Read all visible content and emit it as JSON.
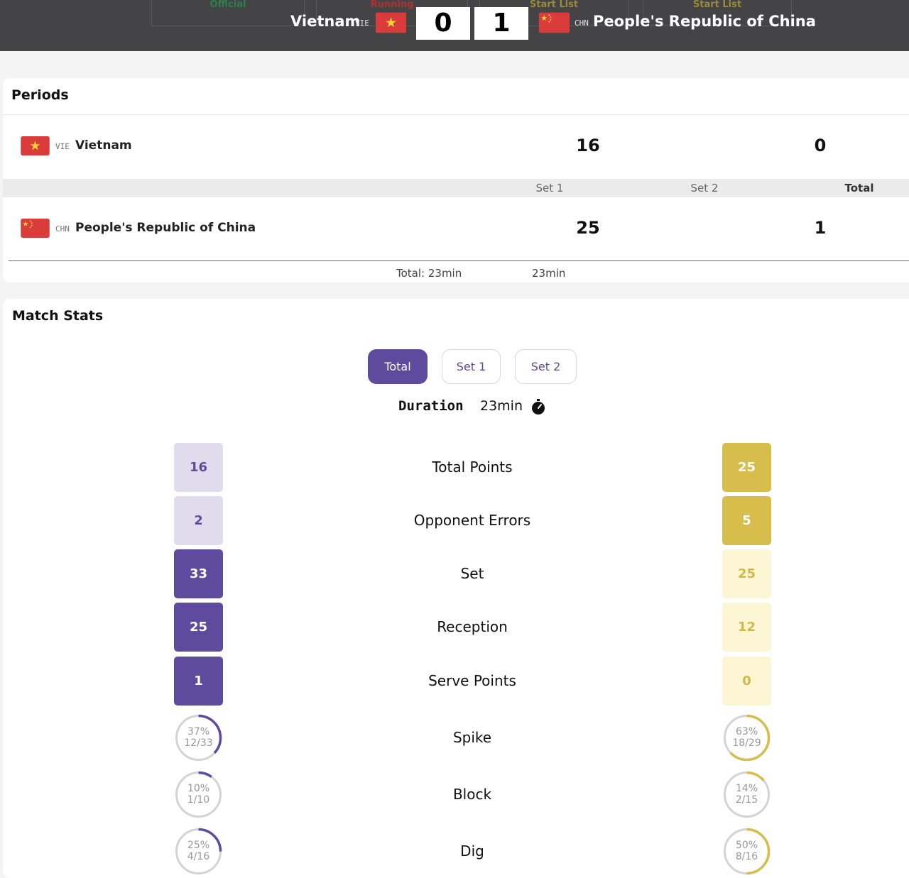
{
  "header": {
    "tabs": [
      {
        "label": "Official",
        "color": "#2e7d4f"
      },
      {
        "label": "Running",
        "color": "#b03030"
      },
      {
        "label": "Start List",
        "color": "#9a8a3a"
      },
      {
        "label": "Start List",
        "color": "#9a8a3a"
      }
    ],
    "home": {
      "name": "Vietnam",
      "code": "VIE",
      "score": "0"
    },
    "away": {
      "name": "People's Republic of China",
      "code": "CHN",
      "score": "1"
    }
  },
  "periods": {
    "title": "Periods",
    "home": {
      "name": "Vietnam",
      "code": "VIE",
      "set1": "16",
      "total": "0"
    },
    "away": {
      "name": "People's Republic of China",
      "code": "CHN",
      "set1": "25",
      "total": "1"
    },
    "columns": {
      "set1": "Set 1",
      "set2": "Set 2",
      "total": "Total"
    },
    "durations": {
      "total": "Total: 23min",
      "set1": "23min"
    }
  },
  "stats": {
    "title": "Match Stats",
    "filters": {
      "total": "Total",
      "set1": "Set 1",
      "set2": "Set 2",
      "active": "Total"
    },
    "duration_label": "Duration",
    "duration_value": "23min",
    "rows": [
      {
        "label": "Total Points",
        "home": "16",
        "away": "25"
      },
      {
        "label": "Opponent Errors",
        "home": "2",
        "away": "5"
      },
      {
        "label": "Set",
        "home": "33",
        "away": "25"
      },
      {
        "label": "Reception",
        "home": "25",
        "away": "12"
      },
      {
        "label": "Serve Points",
        "home": "1",
        "away": "0"
      }
    ],
    "ratios": [
      {
        "label": "Spike",
        "home_pct": "37%",
        "home_frac": "12/33",
        "home_value": 0.37,
        "away_pct": "63%",
        "away_frac": "18/29",
        "away_value": 0.63
      },
      {
        "label": "Block",
        "home_pct": "10%",
        "home_frac": "1/10",
        "home_value": 0.1,
        "away_pct": "14%",
        "away_frac": "2/15",
        "away_value": 0.14
      },
      {
        "label": "Dig",
        "home_pct": "25%",
        "home_frac": "4/16",
        "home_value": 0.25,
        "away_pct": "50%",
        "away_frac": "8/16",
        "away_value": 0.5
      }
    ]
  },
  "colors": {
    "home_accent": "#5f4b9e",
    "away_accent": "#d6bd4c",
    "header_bg": "#444446"
  }
}
